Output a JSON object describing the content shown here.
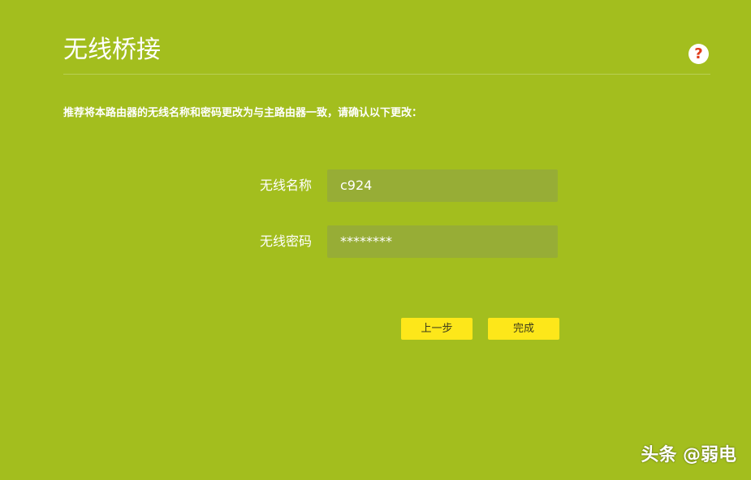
{
  "page": {
    "title": "无线桥接",
    "help_icon": "question-mark",
    "instruction": "推荐将本路由器的无线名称和密码更改为与主路由器一致，请确认以下更改："
  },
  "form": {
    "ssid_label": "无线名称",
    "ssid_value": "c924",
    "password_label": "无线密码",
    "password_value": "********"
  },
  "buttons": {
    "prev_label": "上一步",
    "finish_label": "完成"
  },
  "watermark": {
    "text": "头条 @弱电"
  },
  "colors": {
    "background": "#a3be1e",
    "input_bg": "#97ad36",
    "button_bg": "#fde71a",
    "help_mark": "#e03b1a"
  }
}
